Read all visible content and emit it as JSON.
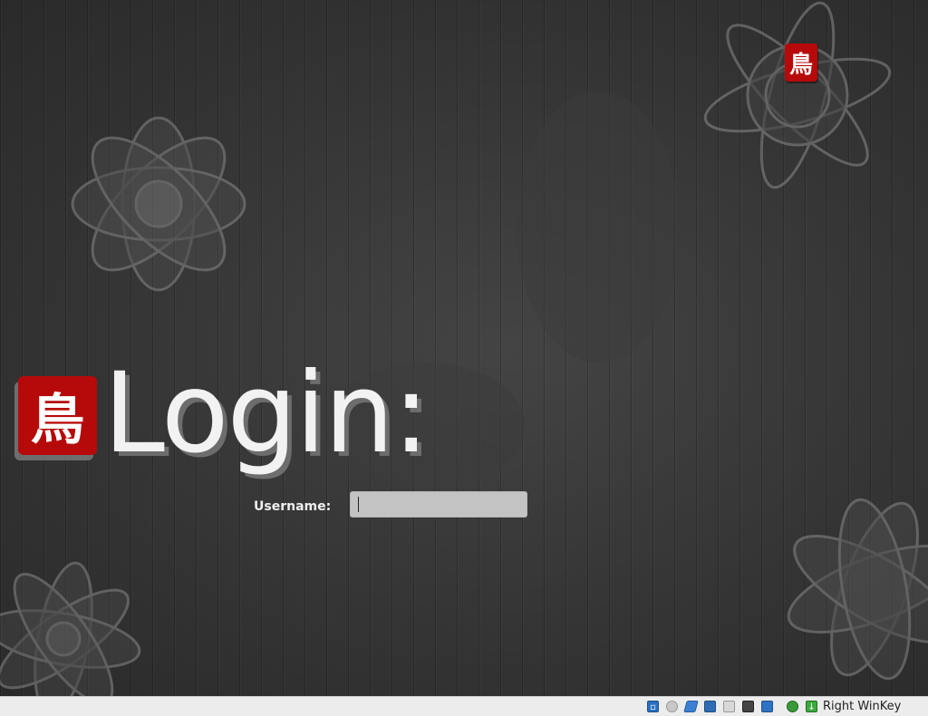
{
  "login": {
    "title": "Login:",
    "username_label": "Username:",
    "username_value": ""
  },
  "branding": {
    "seal_glyph": "鳥",
    "seal_color": "#b60a0a"
  },
  "statusbar": {
    "host_key_label": "Right WinKey",
    "icons": [
      "hard-disk-icon",
      "optical-drive-icon",
      "usb-icon",
      "network-icon",
      "shared-folder-icon",
      "display-icon",
      "video-capture-icon",
      "guest-additions-icon",
      "mouse-integration-icon"
    ]
  }
}
